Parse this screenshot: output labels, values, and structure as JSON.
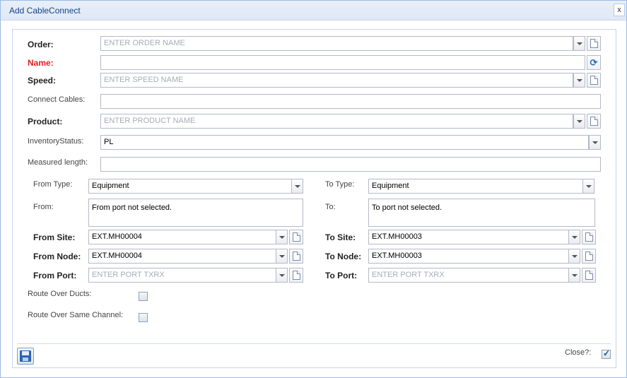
{
  "window": {
    "title": "Add CableConnect",
    "close_label": "x"
  },
  "form": {
    "order": {
      "label": "Order:",
      "placeholder": "ENTER ORDER NAME"
    },
    "name": {
      "label": "Name:",
      "value": ""
    },
    "speed": {
      "label": "Speed:",
      "placeholder": "ENTER SPEED NAME"
    },
    "connect_cables": {
      "label": "Connect Cables:",
      "value": ""
    },
    "product": {
      "label": "Product:",
      "placeholder": "ENTER PRODUCT NAME"
    },
    "inventory_status": {
      "label": "InventoryStatus:",
      "value": "PL"
    },
    "measured_length": {
      "label": "Measured length:",
      "value": ""
    },
    "from_type": {
      "label": "From Type:",
      "value": "Equipment"
    },
    "to_type": {
      "label": "To Type:",
      "value": "Equipment"
    },
    "from": {
      "label": "From:",
      "value": "From port not selected."
    },
    "to": {
      "label": "To:",
      "value": "To port not selected."
    },
    "from_site": {
      "label": "From Site:",
      "value": "EXT.MH00004"
    },
    "to_site": {
      "label": "To Site:",
      "value": "EXT.MH00003"
    },
    "from_node": {
      "label": "From Node:",
      "value": "EXT.MH00004"
    },
    "to_node": {
      "label": "To Node:",
      "value": "EXT.MH00003"
    },
    "from_port": {
      "label": "From Port:",
      "placeholder": "ENTER PORT TXRX"
    },
    "to_port": {
      "label": "To Port:",
      "placeholder": "ENTER PORT TXRX"
    },
    "route_over_ducts": {
      "label": "Route Over Ducts:",
      "checked": false
    },
    "route_over_same_channel": {
      "label": "Route Over Same Channel:",
      "checked": false
    }
  },
  "footer": {
    "close_label": "Close?:",
    "close_checked": true
  },
  "icons": {
    "dropdown": "chevron-down-icon",
    "new": "new-document-icon",
    "refresh": "refresh-icon",
    "save": "floppy-disk-icon",
    "close": "close-icon"
  }
}
